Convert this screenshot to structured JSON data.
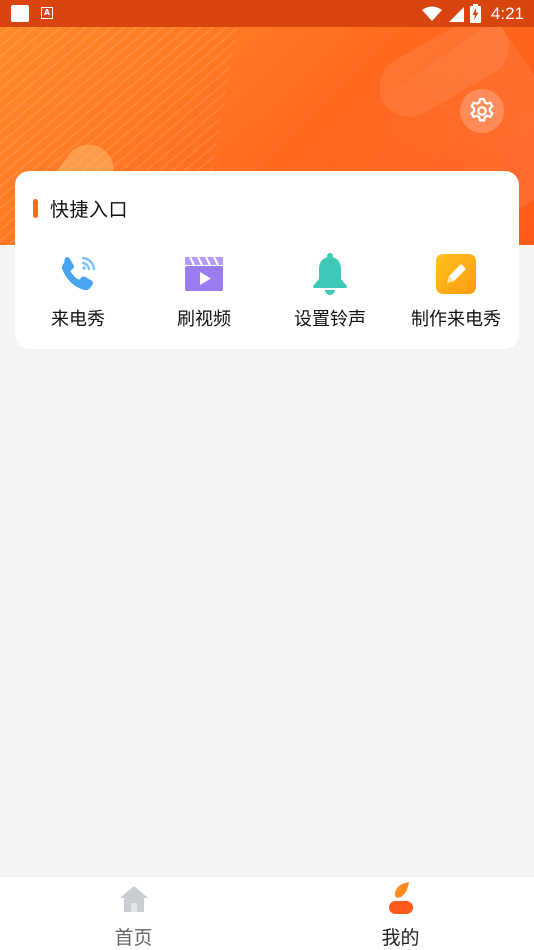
{
  "status_bar": {
    "time": "4:21",
    "icons": [
      "app-notification-icon",
      "text-a-icon",
      "wifi-icon",
      "signal-icon",
      "battery-charging-icon"
    ]
  },
  "header": {
    "settings_icon": "gear-icon"
  },
  "quick_access": {
    "title": "快捷入口",
    "items": [
      {
        "label": "来电秀",
        "icon": "phone-call-icon",
        "color": "#4aa3f0"
      },
      {
        "label": "刷视频",
        "icon": "video-clapper-icon",
        "color": "#9b7cf0"
      },
      {
        "label": "设置铃声",
        "icon": "bell-icon",
        "color": "#3ec9b6"
      },
      {
        "label": "制作来电秀",
        "icon": "edit-pencil-icon",
        "color": "#ffae1a"
      }
    ]
  },
  "bottom_nav": {
    "items": [
      {
        "label": "首页",
        "icon": "home-icon",
        "active": false
      },
      {
        "label": "我的",
        "icon": "profile-icon",
        "active": true
      }
    ]
  },
  "colors": {
    "brand": "#ff6a1f",
    "background": "#f4f4f4"
  }
}
